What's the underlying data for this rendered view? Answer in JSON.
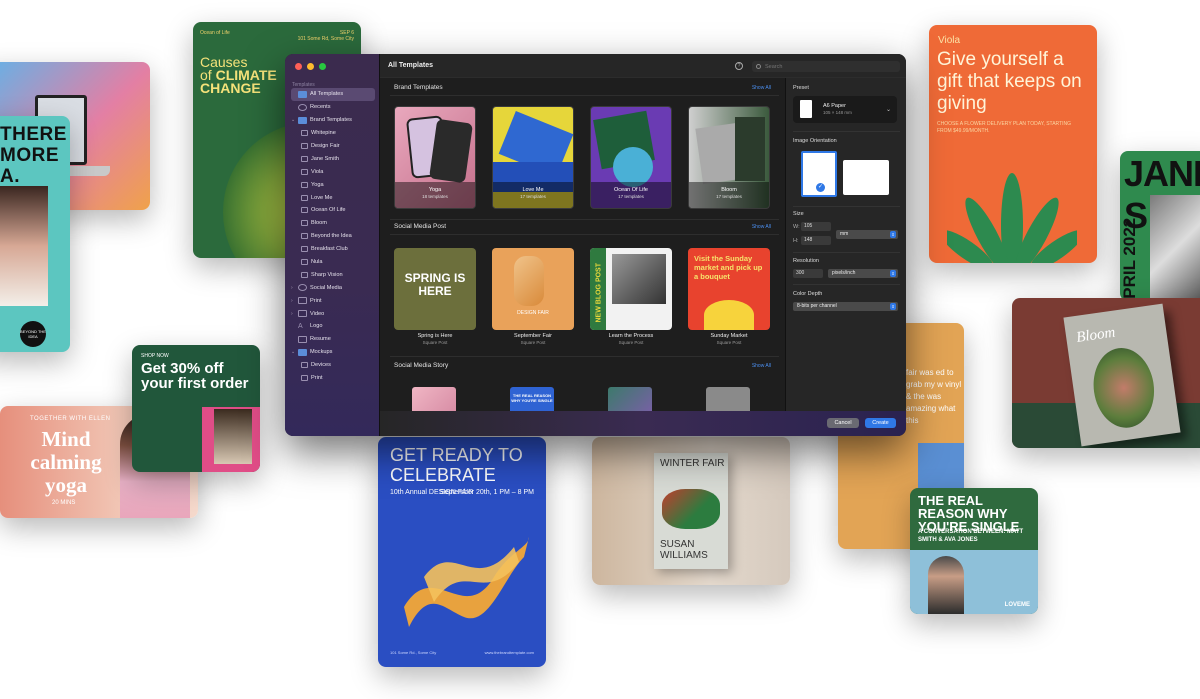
{
  "window": {
    "title": "All Templates",
    "search_placeholder": "Search",
    "help_label": "?"
  },
  "sidebar": {
    "section_label": "Templates",
    "items": [
      {
        "label": "All Templates",
        "selected": true,
        "icon": "grid-icon"
      },
      {
        "label": "Recents",
        "icon": "clock-icon"
      },
      {
        "label": "Brand Templates",
        "icon": "folder-icon",
        "expanded": true
      },
      {
        "label": "Whitepine",
        "icon": "page-icon"
      },
      {
        "label": "Design Fair",
        "icon": "page-icon"
      },
      {
        "label": "Jane Smith",
        "icon": "page-icon"
      },
      {
        "label": "Viola",
        "icon": "page-icon"
      },
      {
        "label": "Yoga",
        "icon": "page-icon"
      },
      {
        "label": "Love Me",
        "icon": "page-icon"
      },
      {
        "label": "Ocean Of Life",
        "icon": "page-icon"
      },
      {
        "label": "Bloom",
        "icon": "page-icon"
      },
      {
        "label": "Beyond the Idea",
        "icon": "page-icon"
      },
      {
        "label": "Breakfast Club",
        "icon": "page-icon"
      },
      {
        "label": "Nula",
        "icon": "page-icon"
      },
      {
        "label": "Sharp Vision",
        "icon": "page-icon"
      },
      {
        "label": "Social Media",
        "icon": "globe-icon"
      },
      {
        "label": "Print",
        "icon": "printer-icon"
      },
      {
        "label": "Video",
        "icon": "video-icon"
      },
      {
        "label": "Logo",
        "icon": "logo-icon"
      },
      {
        "label": "Resume",
        "icon": "resume-icon"
      },
      {
        "label": "Mockups",
        "icon": "mockup-icon",
        "expanded": true
      },
      {
        "label": "Devices",
        "icon": "device-icon"
      },
      {
        "label": "Print",
        "icon": "printer-icon"
      }
    ]
  },
  "sections": {
    "brand": {
      "title": "Brand Templates",
      "show_all": "Show All",
      "tiles": [
        {
          "name": "Yoga",
          "sub": "18 templates"
        },
        {
          "name": "Love Me",
          "sub": "17 templates"
        },
        {
          "name": "Ocean Of Life",
          "sub": "17 templates"
        },
        {
          "name": "Bloom",
          "sub": "17 templates"
        }
      ]
    },
    "social_post": {
      "title": "Social Media Post",
      "show_all": "Show All",
      "tiles": [
        {
          "name": "Spring is Here",
          "sub": "Square Post",
          "art": "SPRING IS HERE"
        },
        {
          "name": "September Fair",
          "sub": "Square Post",
          "art": "DESIGN FAIR"
        },
        {
          "name": "Learn the Process",
          "sub": "Square Post",
          "art": "NEW BLOG POST"
        },
        {
          "name": "Sunday Market",
          "sub": "Square Post",
          "art": "Visit the Sunday market and pick up a bouquet"
        }
      ]
    },
    "social_story": {
      "title": "Social Media Story",
      "show_all": "Show All",
      "art": "THE REAL REASON WHY YOU'RE SINGLE"
    }
  },
  "inspector": {
    "preset_label": "Preset",
    "preset_value": "A6 Paper",
    "preset_size": "105 × 148 mm",
    "orientation_label": "Image Orientation",
    "size_label": "Size",
    "width_label": "W:",
    "width_value": "105",
    "height_label": "H:",
    "height_value": "148",
    "unit": "mm",
    "resolution_label": "Resolution",
    "resolution_value": "300",
    "resolution_unit": "pixels/inch",
    "depth_label": "Color Depth",
    "depth_value": "8-bits per channel"
  },
  "footer": {
    "cancel": "Cancel",
    "create": "Create"
  },
  "posters": {
    "climate": {
      "brand": "Ocean of Life",
      "date": "SEP 6",
      "addr": "101 Some Rd, Some City",
      "line1": "Causes",
      "line2": "of",
      "line3": "CLIMATE",
      "line4": "CHANGE"
    },
    "teal": {
      "text": "THERE MORE A.",
      "badge": "BEYOND THE IDEA"
    },
    "mind": {
      "sub": "TOGETHER WITH ELLEN",
      "title": "Mind calming yoga",
      "mins": "20 MINS"
    },
    "offer": {
      "sub": "SHOP NOW",
      "title": "Get 30% off your first order"
    },
    "viola": {
      "name": "Viola",
      "title": "Give yourself a gift that keeps on giving",
      "sub": "CHOOSE A FLOWER DELIVERY PLAN TODAY, STARTING FROM $49.99/MONTH."
    },
    "jane": {
      "title": "JANE S",
      "date": "APRIL 2022"
    },
    "bloom": {
      "title": "Bloom"
    },
    "sunday": {
      "text": "fair was ed to grab my w vinyl & the was amazing what this"
    },
    "real": {
      "title": "THE REAL REASON WHY YOU'RE SINGLE",
      "sub": "A CONVERSATION BETWEEN: MATT SMITH & AVA JONES",
      "brand": "LOVEME"
    },
    "ready": {
      "title": "GET READY TO CELEBRATE",
      "left": "10th Annual DESIGN FAIR",
      "right": "September 20th, 1 PM – 8 PM",
      "addr": "101 Some Rd., Some City",
      "url": "www.thebrandtemplate.com"
    },
    "winter": {
      "title": "WINTER FAIR",
      "author": "SUSAN WILLIAMS"
    }
  },
  "colors": {
    "accent": "#2f78e6",
    "sidebar": "#3a2b52",
    "window": "#1e1e1e"
  }
}
